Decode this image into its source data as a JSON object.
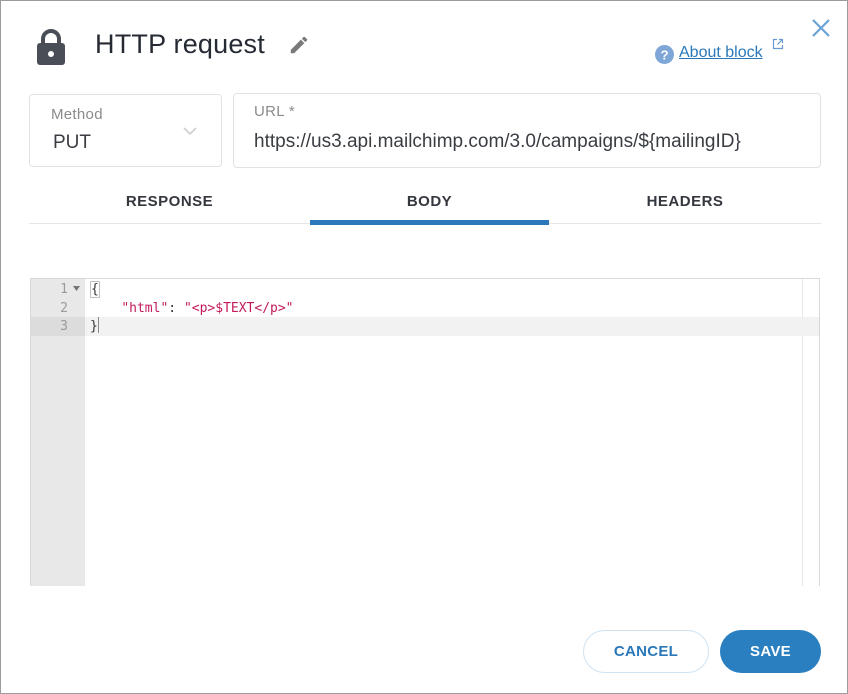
{
  "header": {
    "title": "HTTP request",
    "about_link": "About block"
  },
  "icons": {
    "lock": "lock-icon",
    "edit": "pencil-icon",
    "help": "question-circle-icon",
    "external": "external-link-icon",
    "close": "close-icon",
    "chevron": "chevron-down-icon",
    "fold": "fold-arrow-icon"
  },
  "method": {
    "label": "Method",
    "value": "PUT"
  },
  "url": {
    "label": "URL *",
    "value": "https://us3.api.mailchimp.com/3.0/campaigns/${mailingID}"
  },
  "tabs": [
    {
      "label": "RESPONSE",
      "active": false
    },
    {
      "label": "BODY",
      "active": true
    },
    {
      "label": "HEADERS",
      "active": false
    }
  ],
  "editor": {
    "lines": [
      {
        "number": "1",
        "text": "{"
      },
      {
        "number": "2",
        "key": "\"html\"",
        "sep": ": ",
        "value": "\"<p>$TEXT</p>\""
      },
      {
        "number": "3",
        "text": "}"
      }
    ]
  },
  "footer": {
    "cancel_label": "CANCEL",
    "save_label": "SAVE"
  },
  "colors": {
    "accent": "#2a78b9",
    "save_button": "#2a7fc1",
    "string_token": "#c41a5c",
    "help_icon": "#7ea7d8"
  }
}
